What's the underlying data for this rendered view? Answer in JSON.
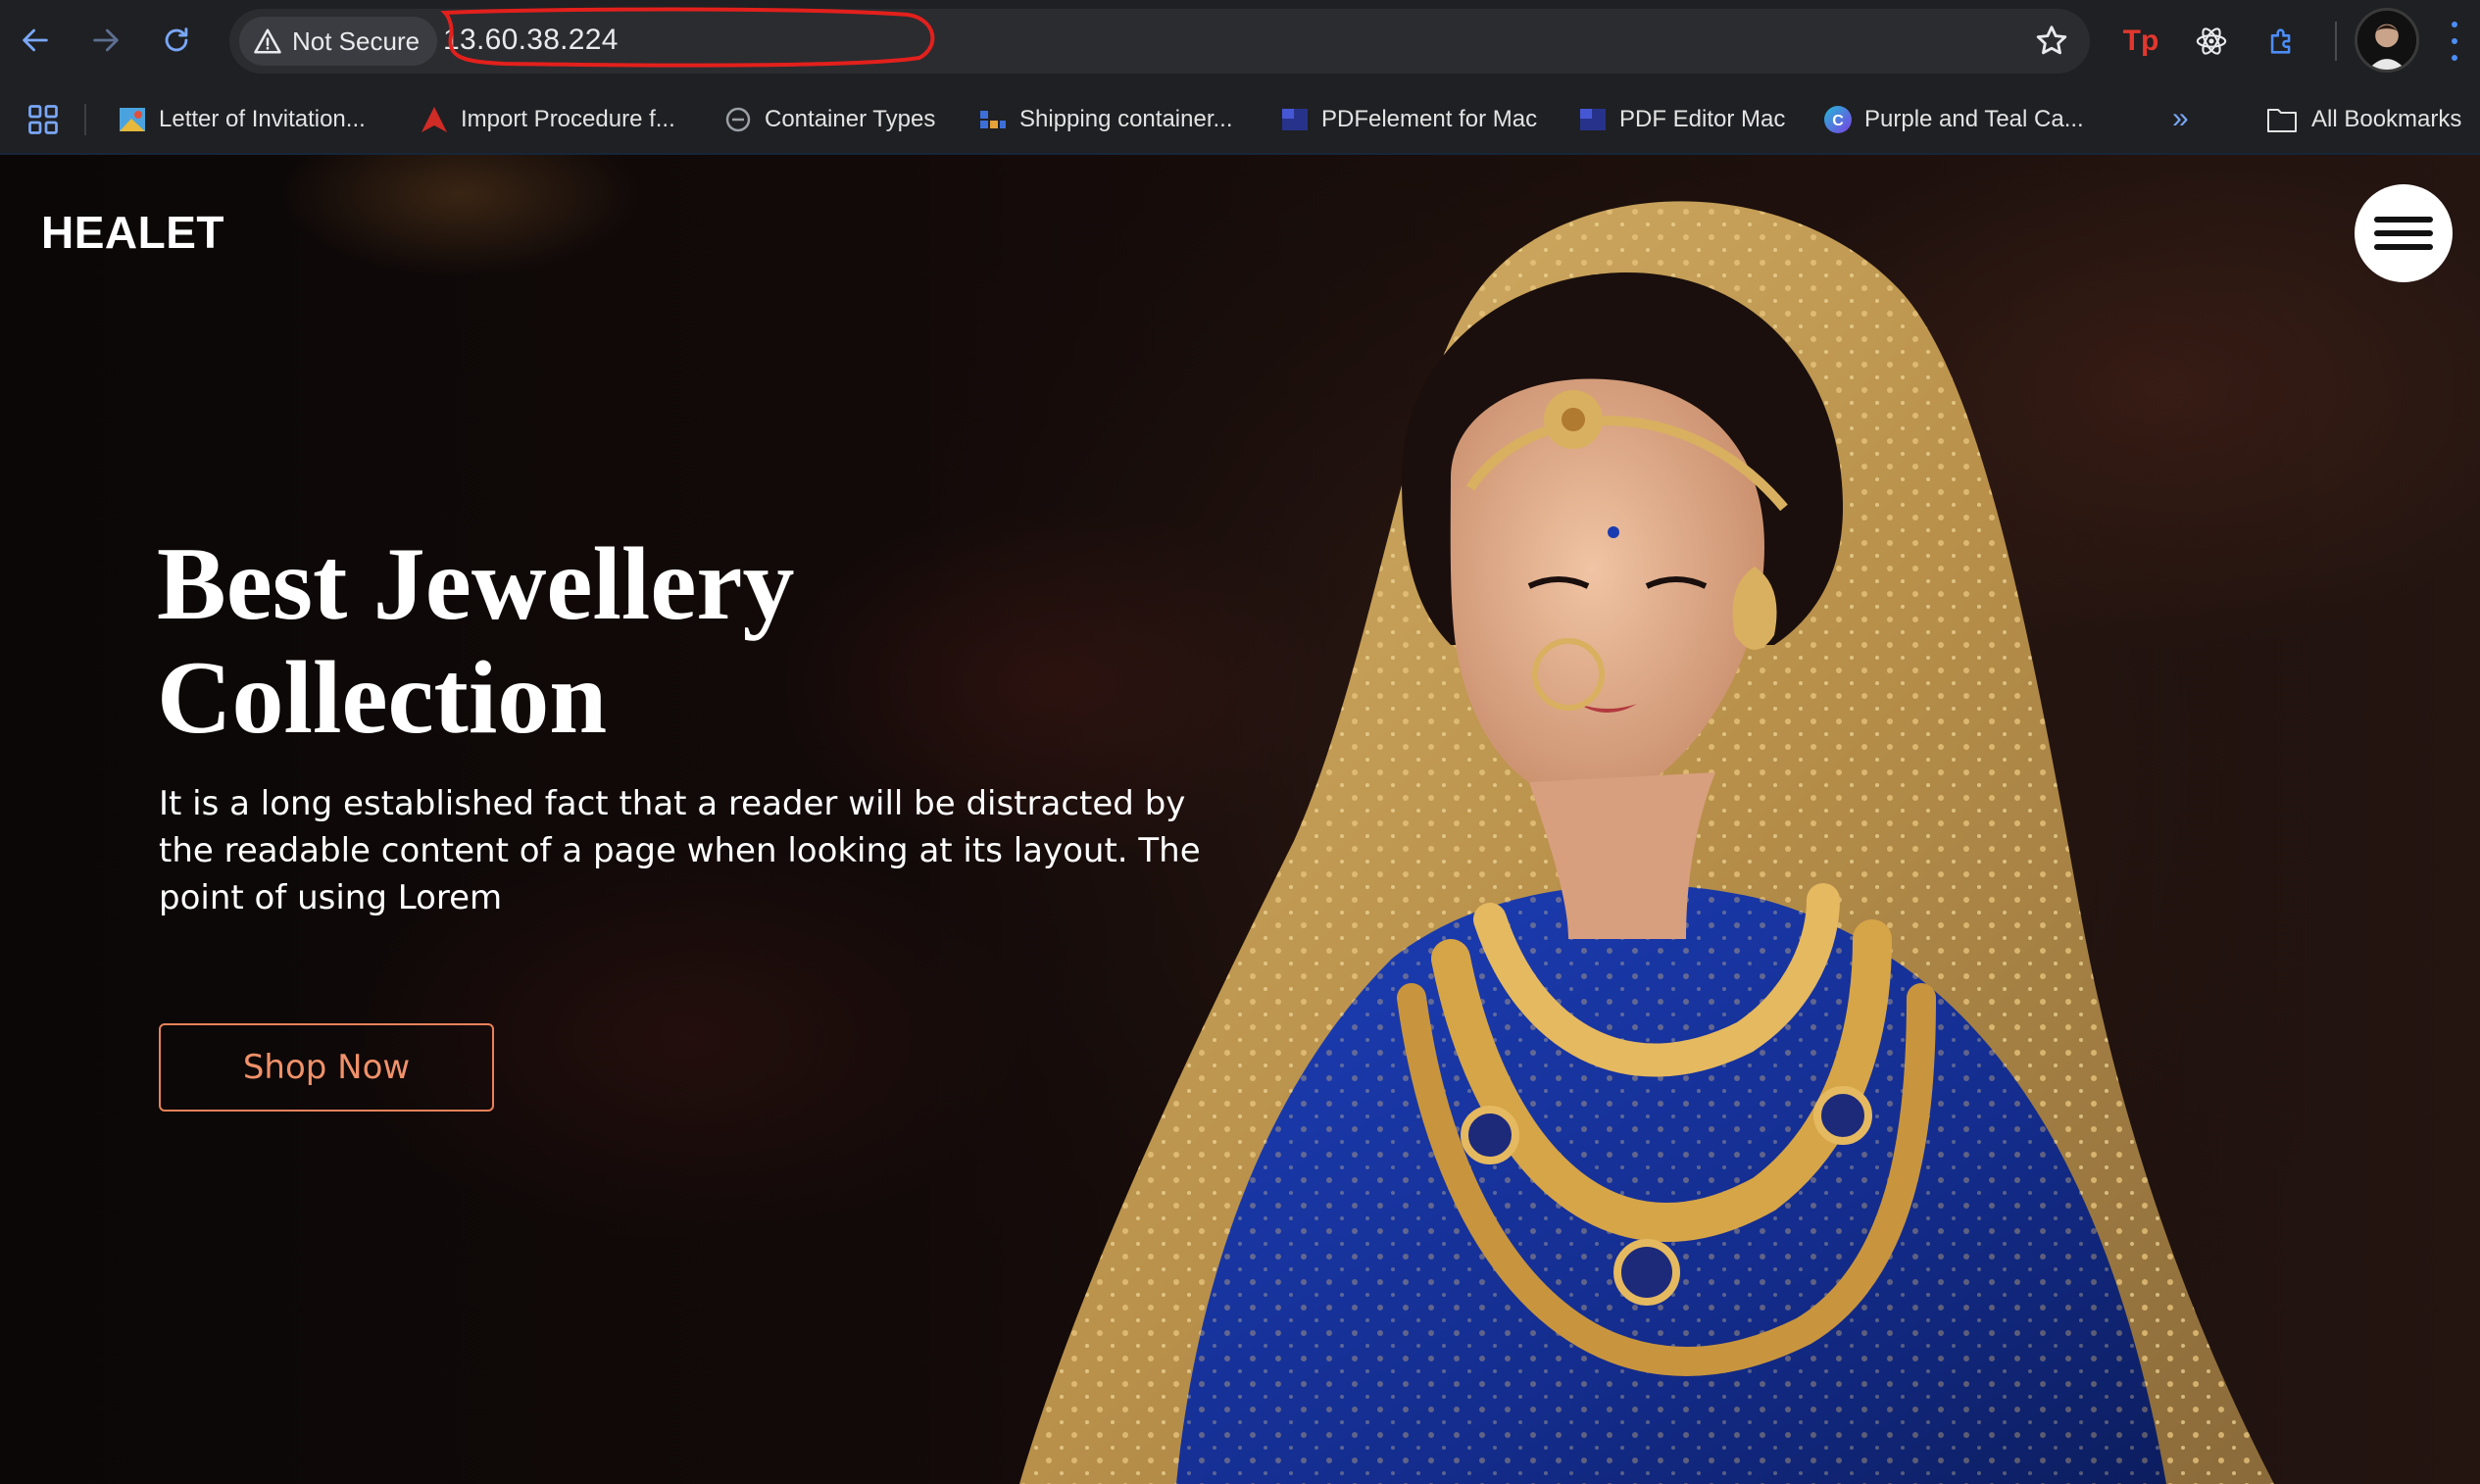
{
  "browser": {
    "security_label": "Not Secure",
    "url": "13.60.38.224",
    "bookmarks": [
      {
        "label": "Letter of Invitation...",
        "icon": "colorful-doc-icon"
      },
      {
        "label": "Import Procedure f...",
        "icon": "red-triangle-icon"
      },
      {
        "label": "Container Types",
        "icon": "container-icon"
      },
      {
        "label": "Shipping container...",
        "icon": "blocks-icon"
      },
      {
        "label": "PDFelement for Mac",
        "icon": "pdf-icon"
      },
      {
        "label": "PDF Editor Mac",
        "icon": "pdf-icon"
      },
      {
        "label": "Purple and Teal Ca...",
        "icon": "canva-icon"
      }
    ],
    "all_bookmarks_label": "All Bookmarks",
    "colors": {
      "chrome_bg": "#1f2023",
      "accent": "#4c8df6",
      "annotation": "#e3201c"
    }
  },
  "site": {
    "brand": "HEALET",
    "hero": {
      "title_line1": "Best Jewellery",
      "title_line2": "Collection",
      "description": "It is a long established fact that a reader will be distracted by the readable content of a page when looking at its layout. The point of using Lorem",
      "cta_label": "Shop Now"
    },
    "colors": {
      "cta": "#f09169",
      "background": "#0b0606"
    }
  }
}
